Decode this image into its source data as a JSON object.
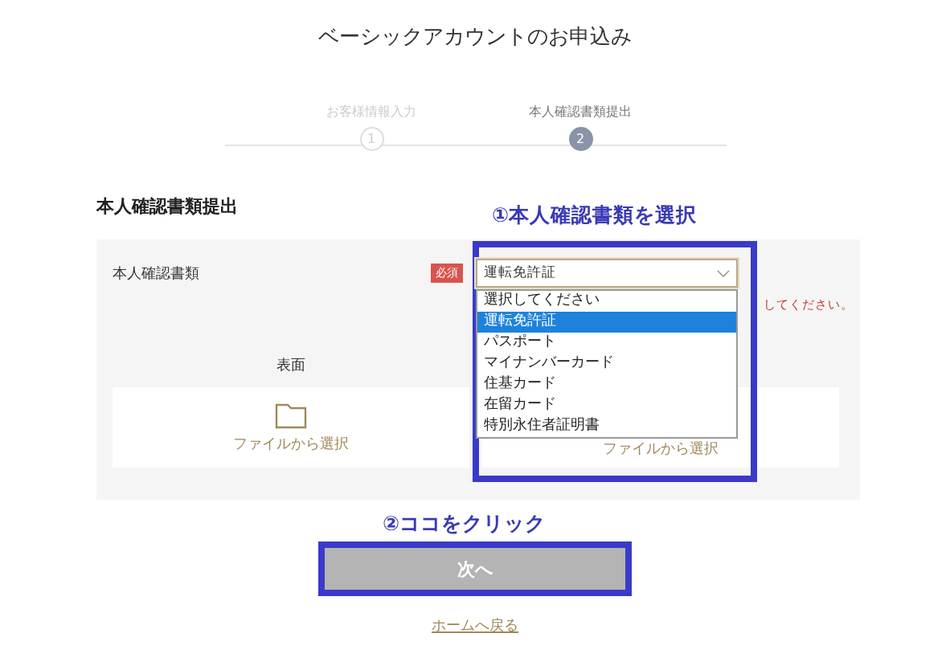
{
  "title": "ベーシックアカウントのお申込み",
  "steps": [
    {
      "label": "お客様情報入力",
      "number": "1",
      "selected": false
    },
    {
      "label": "本人確認書類提出",
      "number": "2",
      "selected": true
    }
  ],
  "section_title": "本人確認書類提出",
  "annotations": [
    {
      "text": "①本人確認書類を選択"
    },
    {
      "text": "②ココをクリック"
    }
  ],
  "form": {
    "label": "本人確認書類",
    "required_badge": "必須",
    "select": {
      "value": "運転免許証",
      "expanded": true,
      "options": [
        {
          "label": "選択してください",
          "selected": false
        },
        {
          "label": "運転免許証",
          "selected": true
        },
        {
          "label": "パスポート",
          "selected": false
        },
        {
          "label": "マイナンバーカード",
          "selected": false
        },
        {
          "label": "住基カード",
          "selected": false
        },
        {
          "label": "在留カード",
          "selected": false
        },
        {
          "label": "特別永住者証明書",
          "selected": false
        }
      ]
    },
    "error_text": "してください。",
    "uploads": [
      {
        "side": "表面",
        "action": "ファイルから選択"
      },
      {
        "action": "ファイルから選択"
      }
    ]
  },
  "next_button": {
    "label": "次へ",
    "disabled": true
  },
  "home_link": "ホームへ戻る"
}
